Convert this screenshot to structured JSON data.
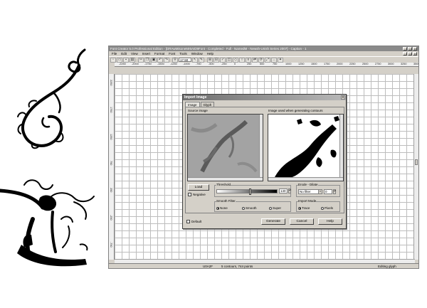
{
  "window": {
    "title": "Font Creator 5.0 Professional Edition - [DRAwMisoneMr6AID9Font - Completed - Full - NamedM - Newsh-Unish Series 2007] - Caption - 1",
    "controls": [
      "_",
      "□",
      "×"
    ]
  },
  "menubar": {
    "items": [
      "File",
      "Edit",
      "View",
      "Insert",
      "Format",
      "Font",
      "Tools",
      "Window",
      "Help"
    ],
    "mdi_controls": [
      "_",
      "□",
      "×"
    ]
  },
  "toolbar": {
    "zoom_value": "17.50",
    "icons": [
      "new-icon",
      "open-icon",
      "save-icon",
      "print-icon",
      "cut-icon",
      "copy-icon",
      "paste-icon",
      "undo-icon",
      "redo-icon",
      "zoom-icon",
      "pointer-icon",
      "pen-icon",
      "grid-icon",
      "metrics-icon",
      "validate-icon",
      "preview-icon"
    ]
  },
  "ruler": {
    "top_ticks": [
      "-2250",
      "-2000",
      "-1750",
      "-1500",
      "-1250",
      "-1000",
      "-750",
      "-500",
      "-250",
      "0",
      "250",
      "500",
      "750",
      "1000",
      "1250",
      "1500",
      "1750",
      "2000",
      "2250",
      "2500",
      "2750",
      "3000",
      "3250",
      "3500"
    ],
    "left_ticks": [
      "2250",
      "1750",
      "1250",
      "750",
      "250",
      "-250",
      "-750"
    ]
  },
  "status": {
    "code": "U0A2F",
    "info": "5 contours, 744 points",
    "mode": "Editing glyph"
  },
  "dialog": {
    "title": "Import Image",
    "close": "×",
    "tabs": [
      "Image",
      "Glyph"
    ],
    "source_label": "Source image",
    "used_label": "Image used when generating contours",
    "load_button": "Load",
    "negative_label": "Negative",
    "threshold_label": "Threshold",
    "threshold_value": "140",
    "threshold_fraction": 0.55,
    "erode_label": "Erode - Dilate",
    "erode_select": "No filter",
    "erode_value": "0",
    "smooth_label": "Smooth Filter",
    "smooth_options": [
      "None",
      "Smooth",
      "Super"
    ],
    "smooth_selected": "None",
    "import_label": "Import Mode",
    "import_options": [
      "Trace",
      "Pixels"
    ],
    "import_selected": "Trace",
    "default_label": "Default",
    "buttons": {
      "generate": "Generate",
      "cancel": "Cancel",
      "help": "Help"
    }
  }
}
